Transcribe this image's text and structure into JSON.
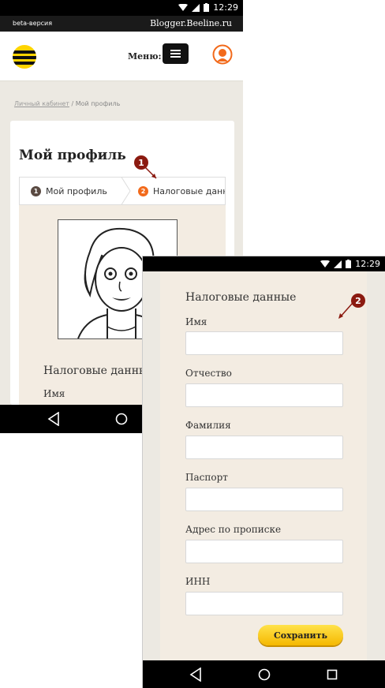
{
  "status_bar": {
    "time": "12:29"
  },
  "beta_bar": {
    "beta_label": "beta-версия",
    "site_name": "Blogger.Beeline.ru"
  },
  "header": {
    "menu_label": "Меню:"
  },
  "breadcrumb": {
    "items": [
      "Личный кабинет",
      "Мой профиль"
    ],
    "separator": "/"
  },
  "page": {
    "title": "Мой профиль",
    "tabs": [
      {
        "number": "1",
        "label": "Мой профиль",
        "color": "#5a4a42"
      },
      {
        "number": "2",
        "label": "Налоговые данные",
        "color": "#f26a1b"
      }
    ]
  },
  "form": {
    "section_title": "Налоговые данные",
    "fields": [
      {
        "label": "Имя",
        "value": ""
      },
      {
        "label": "Отчество",
        "value": ""
      },
      {
        "label": "Фамилия",
        "value": ""
      },
      {
        "label": "Паспорт",
        "value": ""
      },
      {
        "label": "Адрес по прописке",
        "value": ""
      },
      {
        "label": "ИНН",
        "value": ""
      }
    ],
    "save_label": "Сохранить"
  },
  "annotations": {
    "marker1": "1",
    "marker2": "2"
  },
  "colors": {
    "brand_yellow": "#ffd400",
    "accent_orange": "#f26a1b",
    "marker": "#8b1a10"
  },
  "icons": [
    "wifi-icon",
    "signal-icon",
    "battery-icon",
    "beeline-logo",
    "hamburger-icon",
    "user-icon",
    "back-icon",
    "home-icon",
    "recents-icon"
  ]
}
